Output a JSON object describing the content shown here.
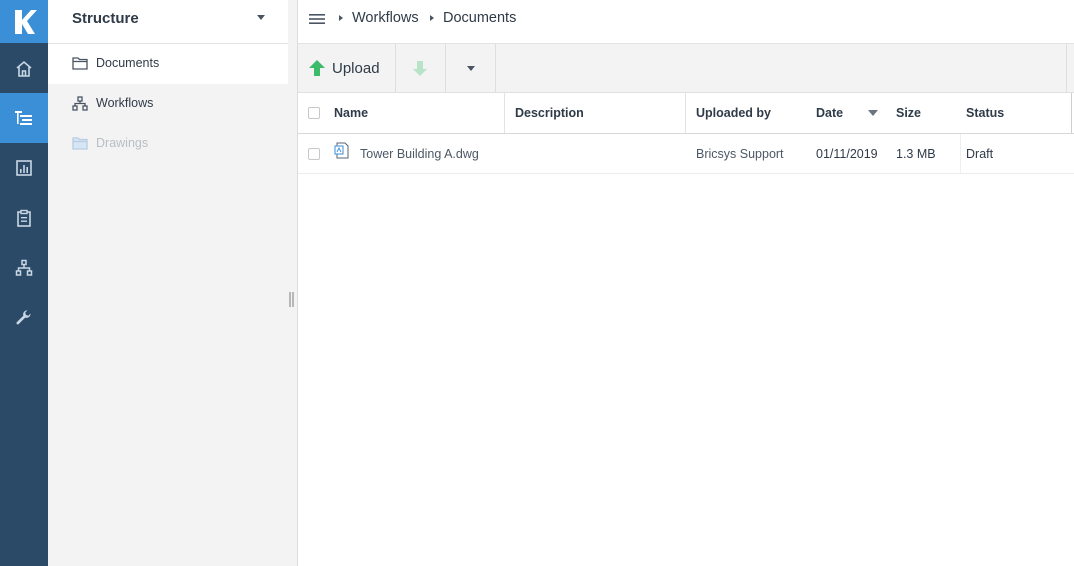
{
  "rail": {
    "items": [
      {
        "icon": "home-icon"
      },
      {
        "icon": "structure-icon",
        "active": true
      },
      {
        "icon": "chart-icon"
      },
      {
        "icon": "clipboard-icon"
      },
      {
        "icon": "workflow-icon"
      },
      {
        "icon": "wrench-icon"
      }
    ]
  },
  "structure": {
    "title": "Structure",
    "items": [
      {
        "label": "Documents",
        "icon": "folder-icon",
        "selected": true
      },
      {
        "label": "Workflows",
        "icon": "workflow-icon"
      },
      {
        "label": "Drawings",
        "icon": "folder-icon",
        "disabled": true
      }
    ]
  },
  "breadcrumb": [
    "Workflows",
    "Documents"
  ],
  "toolbar": {
    "upload_label": "Upload"
  },
  "table": {
    "columns": [
      "Name",
      "Description",
      "Uploaded by",
      "Date",
      "Size",
      "Status"
    ],
    "sort_column": "Date",
    "rows": [
      {
        "name": "Tower Building A.dwg",
        "description": "",
        "uploaded_by": "Bricsys Support",
        "date": "01/11/2019",
        "size": "1.3 MB",
        "status": "Draft"
      }
    ]
  },
  "colors": {
    "rail": "#2b4a68",
    "accent": "#3a8fd6",
    "upload_arrow": "#3dbb6b"
  }
}
